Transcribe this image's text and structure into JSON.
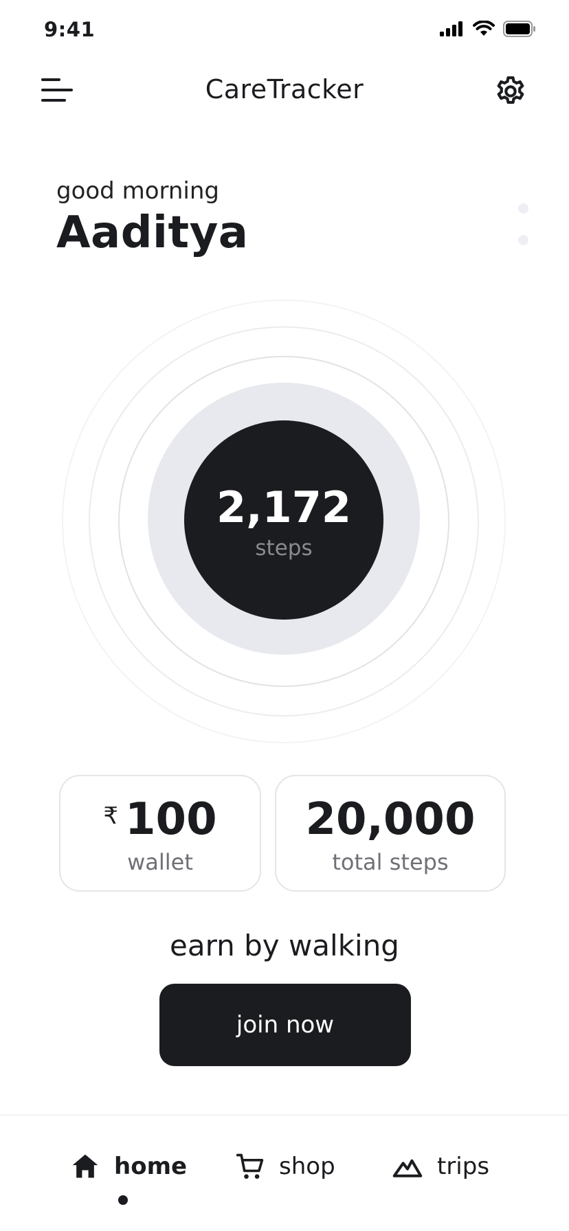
{
  "status_bar": {
    "time": "9:41"
  },
  "header": {
    "title": "CareTracker"
  },
  "greeting": {
    "salutation": "good morning",
    "name": "Aaditya"
  },
  "steps": {
    "value": "2,172",
    "label": "steps"
  },
  "stats": [
    {
      "currency": "₹",
      "value": "100",
      "label": "wallet"
    },
    {
      "value": "20,000",
      "label": "total steps"
    }
  ],
  "cta": {
    "title": "earn by walking",
    "button_label": "join now"
  },
  "nav": {
    "items": [
      {
        "label": "home",
        "icon": "home-icon",
        "active": true
      },
      {
        "label": "shop",
        "icon": "cart-icon",
        "active": false
      },
      {
        "label": "trips",
        "icon": "mountain-icon",
        "active": false
      }
    ]
  },
  "colors": {
    "primary": "#1b1c1f",
    "muted": "#8a8b8f",
    "ring_fill": "#e8e9ee"
  }
}
